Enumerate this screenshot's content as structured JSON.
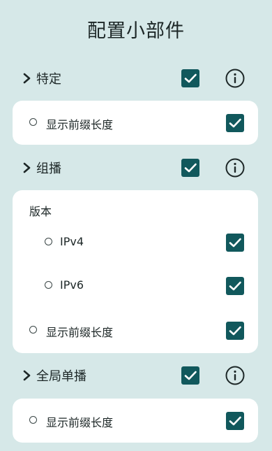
{
  "header": {
    "title": "配置小部件"
  },
  "sections": [
    {
      "label": "特定",
      "checked": true,
      "options": [
        {
          "label": "显示前缀长度",
          "checked": true
        }
      ]
    },
    {
      "label": "组播",
      "checked": true,
      "group_title": "版本",
      "options": [
        {
          "label": "IPv4",
          "checked": true
        },
        {
          "label": "IPv6",
          "checked": true
        },
        {
          "label": "显示前缀长度",
          "checked": true
        }
      ]
    },
    {
      "label": "全局单播",
      "checked": true,
      "options": [
        {
          "label": "显示前缀长度",
          "checked": true
        }
      ]
    }
  ],
  "icons": {
    "expand": "chevron-right-icon",
    "info": "info-icon",
    "option": "radio-circle-icon",
    "check": "checkmark-icon"
  },
  "colors": {
    "background": "#d6e8e8",
    "card": "#ffffff",
    "accent": "#11585c",
    "text": "#1d2727"
  }
}
